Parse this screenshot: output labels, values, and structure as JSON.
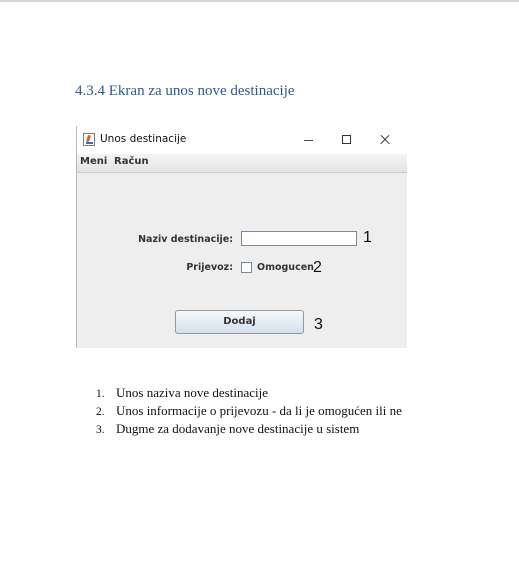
{
  "document": {
    "heading": "4.3.4 Ekran za unos nove destinacije"
  },
  "window": {
    "title": "Unos destinacije",
    "menu": [
      "Meni",
      "Račun"
    ],
    "form": {
      "naziv_label": "Naziv destinacije:",
      "naziv_value": "",
      "prijevoz_label": "Prijevoz:",
      "checkbox_label": "Omogucen",
      "checkbox_checked": false,
      "button_label": "Dodaj"
    },
    "callouts": [
      "1",
      "2",
      "3"
    ]
  },
  "list": [
    {
      "num": "1.",
      "text": "Unos naziva nove destinacije"
    },
    {
      "num": "2.",
      "text": "Unos informacije o prijevozu -  da li je omogućen ili ne"
    },
    {
      "num": "3.",
      "text": "Dugme za dodavanje nove destinacije u sistem"
    }
  ]
}
